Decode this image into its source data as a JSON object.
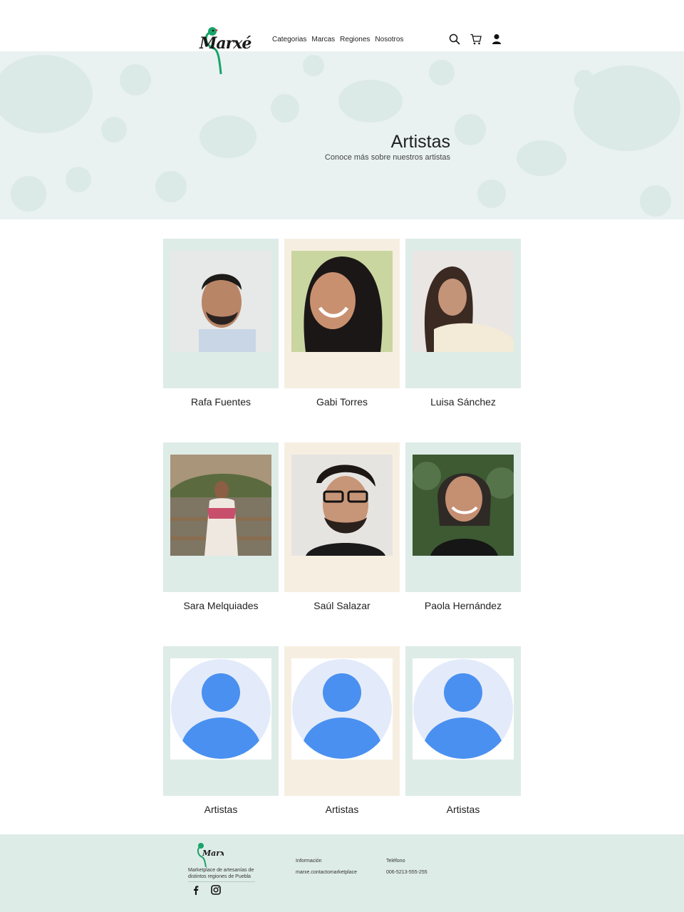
{
  "brand": {
    "name": "Marxé"
  },
  "nav": [
    "Categorias",
    "Marcas",
    "Regiones",
    "Nosotros"
  ],
  "header_icons": [
    "search-icon",
    "cart-icon",
    "user-icon"
  ],
  "hero": {
    "title": "Artistas",
    "subtitle": "Conoce más sobre nuestros artistas"
  },
  "colors": {
    "card_green": "#deece8",
    "card_cream": "#f6efe1",
    "hero_bg": "#e9f2f1",
    "avatar_blue": "#4a90f0",
    "avatar_bg": "#e3ebfa"
  },
  "artists": [
    {
      "name": "Rafa Fuentes",
      "photo": "man-portrait",
      "bg": "green"
    },
    {
      "name": "Gabi Torres",
      "photo": "woman-portrait",
      "bg": "cream"
    },
    {
      "name": "Luisa Sánchez",
      "photo": "woman-portrait",
      "bg": "green"
    },
    {
      "name": "Sara Melquiades",
      "photo": "woman-outdoor-portrait",
      "bg": "green"
    },
    {
      "name": "Saúl Salazar",
      "photo": "man-glasses-portrait",
      "bg": "cream"
    },
    {
      "name": "Paola Hernández",
      "photo": "woman-portrait",
      "bg": "green"
    },
    {
      "name": "Artistas",
      "photo": "avatar-placeholder",
      "bg": "green"
    },
    {
      "name": "Artistas",
      "photo": "avatar-placeholder",
      "bg": "cream"
    },
    {
      "name": "Artistas",
      "photo": "avatar-placeholder",
      "bg": "green"
    }
  ],
  "footer": {
    "description": "Marketplace de artesanías de distintos regiones de Puebla",
    "info_label": "Información",
    "info_value": "marxe.contactomarketplace",
    "phone_label": "Teléfono",
    "phone_value": "006-5213-555-255",
    "social": [
      "facebook-icon",
      "instagram-icon"
    ]
  }
}
